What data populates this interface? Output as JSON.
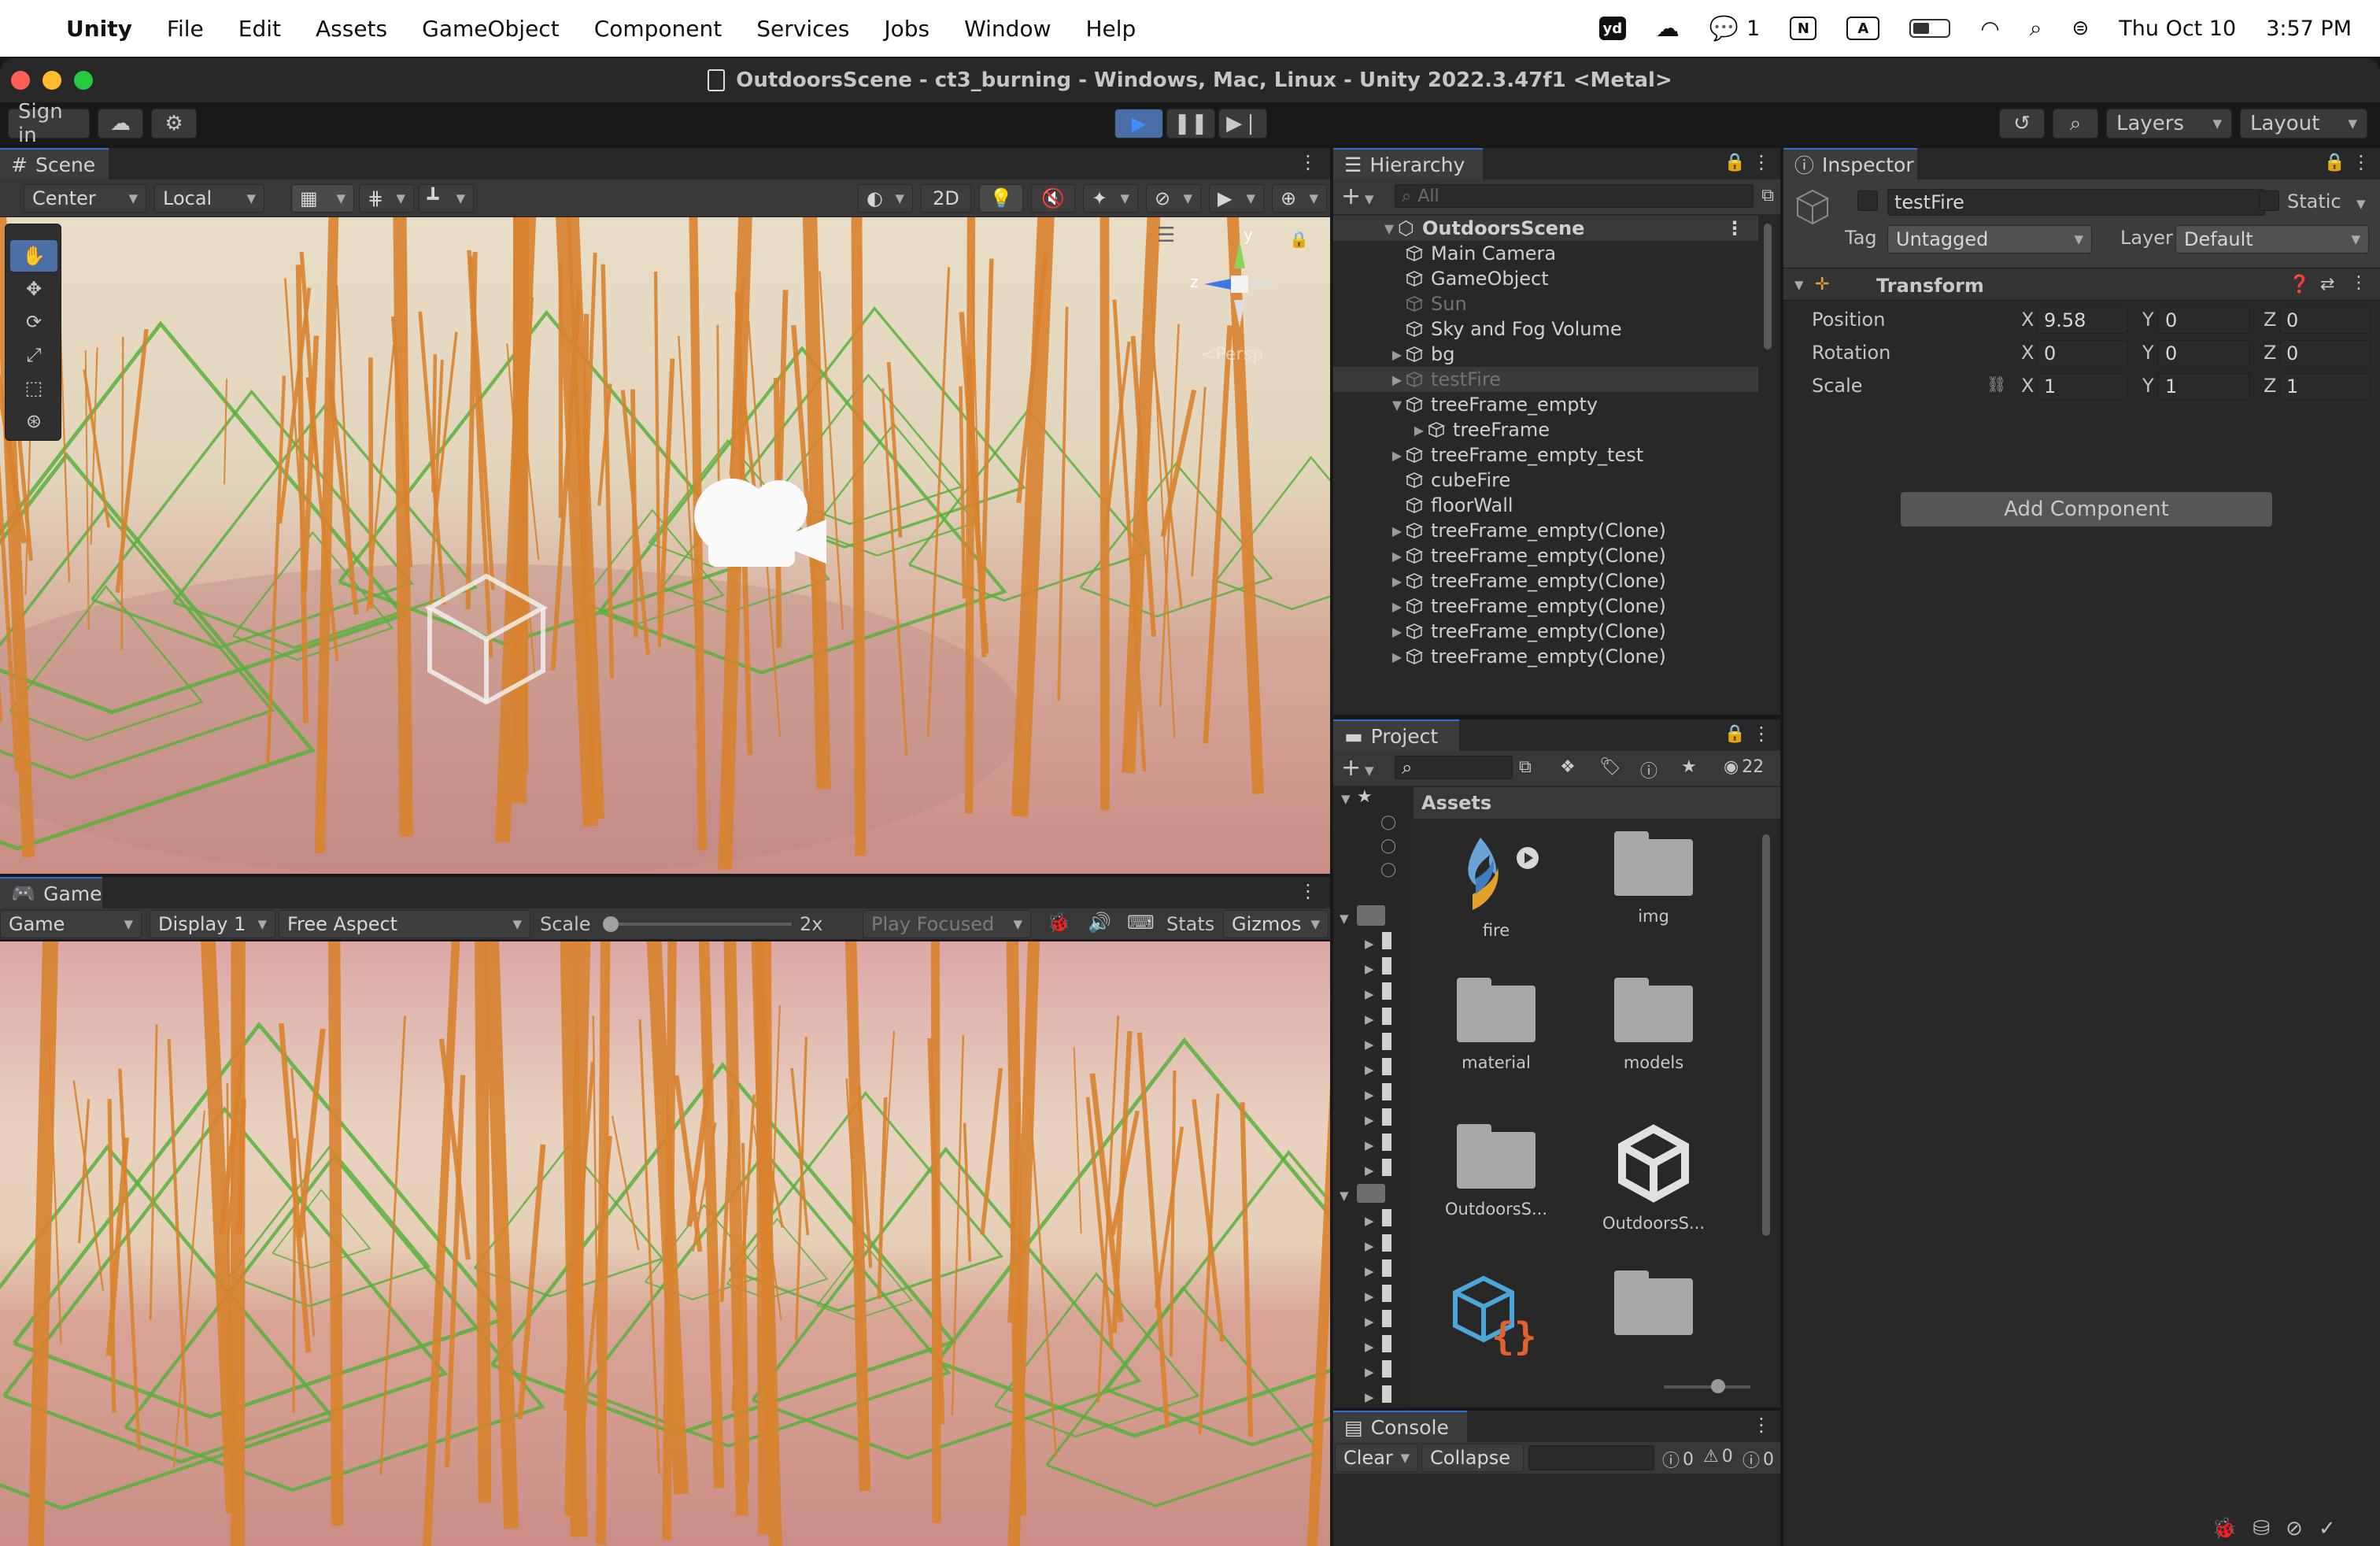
{
  "menubar": {
    "app": "Unity",
    "items": [
      "File",
      "Edit",
      "Assets",
      "GameObject",
      "Component",
      "Services",
      "Jobs",
      "Window",
      "Help"
    ],
    "status": {
      "wechat_count": "1",
      "input_n": "N",
      "input_a": "A",
      "date": "Thu Oct 10",
      "time": "3:57 PM"
    }
  },
  "window": {
    "title": "OutdoorsScene - ct3_burning - Windows, Mac, Linux - Unity 2022.3.47f1 <Metal>"
  },
  "toolbar": {
    "sign_in": "Sign in",
    "layers": "Layers",
    "layout": "Layout"
  },
  "scene": {
    "tab": "Scene",
    "pivot": "Center",
    "space": "Local",
    "mode_2d": "2D",
    "persp_label": "<Persp",
    "gizmo_y": "y",
    "gizmo_z": "z"
  },
  "game": {
    "tab": "Game",
    "view": "Game",
    "display": "Display 1",
    "aspect": "Free Aspect",
    "scale_label": "Scale",
    "scale_value": "2x",
    "scale_level": 0.0,
    "play_focused": "Play Focused",
    "stats": "Stats",
    "gizmos": "Gizmos"
  },
  "hierarchy": {
    "tab": "Hierarchy",
    "search_placeholder": "All",
    "root": "OutdoorsScene",
    "rows": [
      {
        "label": "Main Camera",
        "depth": 1,
        "arrow": "",
        "dim": false,
        "selected": false
      },
      {
        "label": "GameObject",
        "depth": 1,
        "arrow": "",
        "dim": false,
        "selected": false
      },
      {
        "label": "Sun",
        "depth": 1,
        "arrow": "",
        "dim": true,
        "selected": false
      },
      {
        "label": "Sky and Fog Volume",
        "depth": 1,
        "arrow": "",
        "dim": false,
        "selected": false
      },
      {
        "label": "bg",
        "depth": 1,
        "arrow": "▶",
        "dim": false,
        "selected": false
      },
      {
        "label": "testFire",
        "depth": 1,
        "arrow": "▶",
        "dim": true,
        "selected": true
      },
      {
        "label": "treeFrame_empty",
        "depth": 1,
        "arrow": "▼",
        "dim": false,
        "selected": false
      },
      {
        "label": "treeFrame",
        "depth": 2,
        "arrow": "▶",
        "dim": false,
        "selected": false
      },
      {
        "label": "treeFrame_empty_test",
        "depth": 1,
        "arrow": "▶",
        "dim": false,
        "selected": false
      },
      {
        "label": "cubeFire",
        "depth": 1,
        "arrow": "",
        "dim": false,
        "selected": false
      },
      {
        "label": "floorWall",
        "depth": 1,
        "arrow": "",
        "dim": false,
        "selected": false
      },
      {
        "label": "treeFrame_empty(Clone)",
        "depth": 1,
        "arrow": "▶",
        "dim": false,
        "selected": false
      },
      {
        "label": "treeFrame_empty(Clone)",
        "depth": 1,
        "arrow": "▶",
        "dim": false,
        "selected": false
      },
      {
        "label": "treeFrame_empty(Clone)",
        "depth": 1,
        "arrow": "▶",
        "dim": false,
        "selected": false
      },
      {
        "label": "treeFrame_empty(Clone)",
        "depth": 1,
        "arrow": "▶",
        "dim": false,
        "selected": false
      },
      {
        "label": "treeFrame_empty(Clone)",
        "depth": 1,
        "arrow": "▶",
        "dim": false,
        "selected": false
      },
      {
        "label": "treeFrame_empty(Clone)",
        "depth": 1,
        "arrow": "▶",
        "dim": false,
        "selected": false
      }
    ]
  },
  "project": {
    "tab": "Project",
    "hidden_count": "22",
    "breadcrumb": "Assets",
    "assets": [
      {
        "label": "fire",
        "kind": "fire"
      },
      {
        "label": "img",
        "kind": "folder"
      },
      {
        "label": "material",
        "kind": "folder"
      },
      {
        "label": "models",
        "kind": "folder"
      },
      {
        "label": "OutdoorsS...",
        "kind": "folder"
      },
      {
        "label": "OutdoorsS...",
        "kind": "unity"
      },
      {
        "label": "",
        "kind": "script"
      },
      {
        "label": "",
        "kind": "folder"
      }
    ]
  },
  "console": {
    "tab": "Console",
    "clear": "Clear",
    "collapse": "Collapse",
    "info_count": "0",
    "warn_count": "0",
    "error_count": "0"
  },
  "inspector": {
    "tab": "Inspector",
    "object_name": "testFire",
    "static_label": "Static",
    "tag_label": "Tag",
    "tag_value": "Untagged",
    "layer_label": "Layer",
    "layer_value": "Default",
    "component": "Transform",
    "rows": [
      {
        "label": "Position",
        "x": "9.58",
        "y": "0",
        "z": "0"
      },
      {
        "label": "Rotation",
        "x": "0",
        "y": "0",
        "z": "0"
      },
      {
        "label": "Scale",
        "x": "1",
        "y": "1",
        "z": "1"
      }
    ],
    "add_component": "Add Component"
  },
  "colors": {
    "accent": "#2d6fd6",
    "trunk": "#d9832f",
    "frame": "#58b03c"
  }
}
